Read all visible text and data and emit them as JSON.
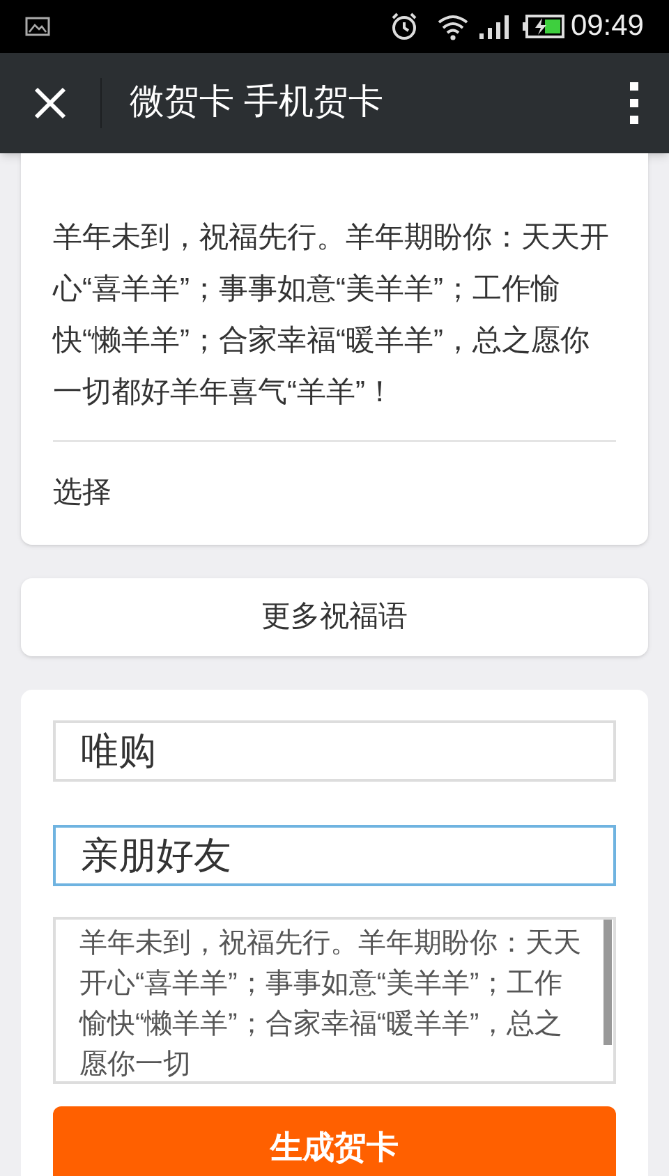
{
  "status_bar": {
    "time": "09:49"
  },
  "header": {
    "title": "微贺卡 手机贺卡"
  },
  "greeting_card": {
    "message": "羊年未到，祝福先行。羊年期盼你：天天开心“喜羊羊”；事事如意“美羊羊”；工作愉快“懒羊羊”；合家幸福“暖羊羊”，总之愿你一切都好羊年喜气“羊羊”！",
    "select_label": "选择"
  },
  "more_button": "更多祝福语",
  "form": {
    "fields": [
      {
        "value": "唯购",
        "focused": false
      },
      {
        "value": "亲朋好友",
        "focused": true
      }
    ],
    "message": "羊年未到，祝福先行。羊年期盼你：天天开心“喜羊羊”；事事如意“美羊羊”；工作愉快“懒羊羊”；合家幸福“暖羊羊”，总之愿你一切",
    "submit": "生成贺卡"
  }
}
